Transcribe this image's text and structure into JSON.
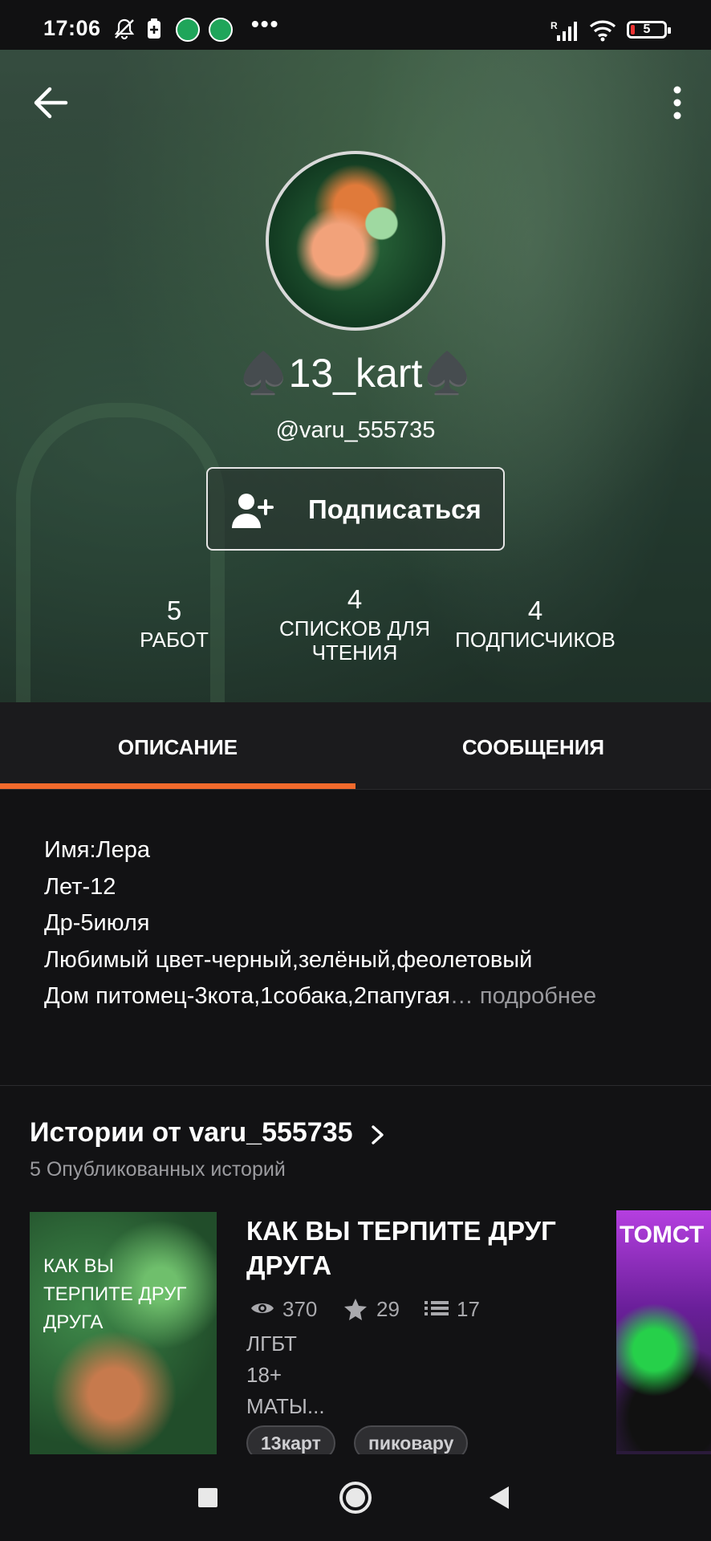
{
  "status_bar": {
    "time": "17:06",
    "battery_level": "5",
    "icons": [
      "bell-off-icon",
      "battery-saver-icon",
      "app-notification-icon",
      "app-notification-icon",
      "more-dots-icon",
      "signal-icon",
      "wifi-icon",
      "battery-icon"
    ]
  },
  "header": {
    "back_icon": "arrow-left-icon",
    "menu_icon": "more-vertical-icon"
  },
  "profile": {
    "display_name": "♠️13_kart♠️",
    "username": "@varu_555735",
    "follow_label": "Подписаться",
    "follow_icon": "add-user-icon",
    "stats": [
      {
        "number": "5",
        "label": "РАБОТ"
      },
      {
        "number": "4",
        "label": "СПИСКОВ ДЛЯ ЧТЕНИЯ"
      },
      {
        "number": "4",
        "label": "ПОДПИСЧИКОВ"
      }
    ]
  },
  "tabs": [
    {
      "label": "ОПИСАНИЕ",
      "active": true
    },
    {
      "label": "СООБЩЕНИЯ",
      "active": false
    }
  ],
  "description": {
    "lines": [
      "Имя:Лера",
      "Лет-12",
      "Др-5июля",
      "Любимый цвет-черный,зелёный,феолетовый",
      "Дом питомец-3кота,1собака,2папугая"
    ],
    "ellipsis": "…",
    "more_label": "подробнее"
  },
  "stories": {
    "title": "Истории от varu_555735",
    "subtitle": "5 Опубликованных историй",
    "items": [
      {
        "cover_text": "КАК ВЫ ТЕРПИТЕ ДРУГ ДРУГА",
        "title": "КАК ВЫ ТЕРПИТЕ ДРУГ ДРУГА",
        "views": "370",
        "votes": "29",
        "parts": "17",
        "description_lines": [
          "ЛГБТ",
          "18+",
          "МАТЫ..."
        ],
        "tags": [
          "13карт",
          "пиковару"
        ]
      },
      {
        "cover_text": "ТОМСТ"
      }
    ]
  },
  "nav_bar": {
    "icons": [
      "recent-apps-icon",
      "home-icon",
      "back-icon"
    ]
  },
  "colors": {
    "background": "#121214",
    "tab_indicator": "#f26a2c",
    "muted_text": "#9b9b9f"
  }
}
